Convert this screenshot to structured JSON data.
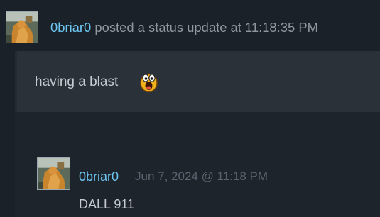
{
  "post": {
    "author": "0briar0",
    "action_text": " posted a status update at 11:18:35 PM",
    "status_text": "having a blast",
    "emoticon": "laughing-emoticon-icon"
  },
  "comment": {
    "author": "0briar0",
    "date": "Jun 7, 2024 @ 11:18 PM",
    "text": "DALL 911"
  },
  "colors": {
    "background": "#1b2128",
    "panel": "#2a3138",
    "username": "#6dc6f2",
    "muted_text": "#8f98a0",
    "body_text": "#c5cbd2"
  }
}
